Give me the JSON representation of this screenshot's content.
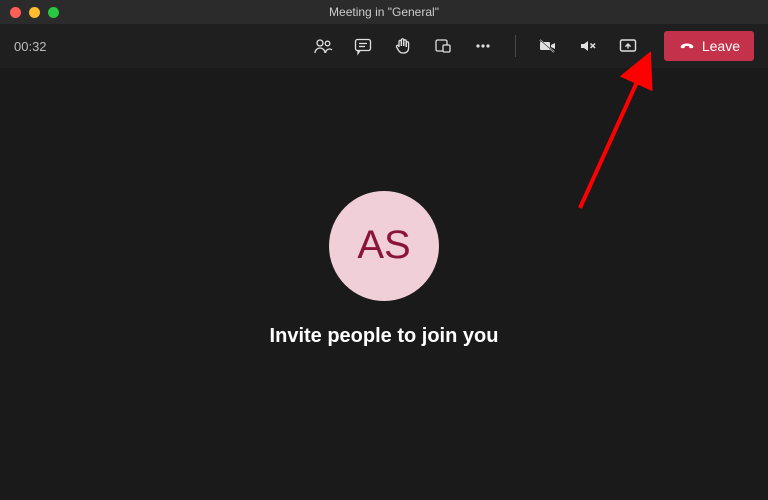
{
  "window": {
    "title": "Meeting in \"General\""
  },
  "toolbar": {
    "timer": "00:32",
    "leave_label": "Leave"
  },
  "participant": {
    "initials": "AS"
  },
  "main": {
    "invite_prompt": "Invite people to join you"
  },
  "colors": {
    "leave_button": "#c4314b",
    "avatar_bg": "#f0cfd8",
    "avatar_fg": "#8a1538",
    "annotation_arrow": "#ff0000"
  }
}
